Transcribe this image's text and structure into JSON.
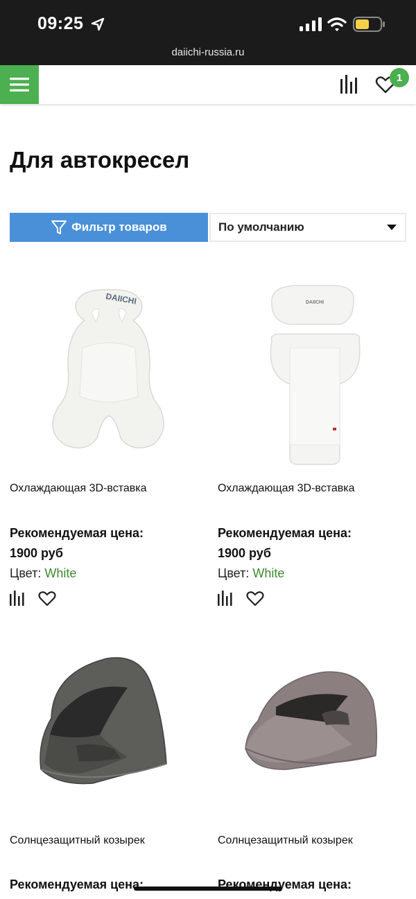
{
  "status_bar": {
    "time": "09:25",
    "url": "daiichi-russia.ru",
    "icons": [
      "location-arrow-icon",
      "signal-icon",
      "wifi-icon",
      "battery-icon"
    ]
  },
  "header": {
    "menu_icon": "hamburger-icon",
    "compare_icon": "compare-icon",
    "favorites_icon": "heart-icon",
    "favorites_count": "1",
    "accent_color": "#4caf50"
  },
  "page": {
    "title": "Для автокресел"
  },
  "filter": {
    "filter_label": "Фильтр товаров",
    "filter_icon": "funnel-icon",
    "filter_color": "#4a90d9",
    "sort_selected": "По умолчанию",
    "sort_icon": "caret-down-icon"
  },
  "products": [
    {
      "name": "Охлаждающая 3D-вставка",
      "price_label": "Рекомендуемая цена:",
      "price": "1900 руб",
      "color_label": "Цвет:",
      "color_value": "White",
      "image_text": "DAIICHI"
    },
    {
      "name": "Охлаждающая 3D-вставка",
      "price_label": "Рекомендуемая цена:",
      "price": "1900 руб",
      "color_label": "Цвет:",
      "color_value": "White",
      "image_text": "DAIICHI"
    },
    {
      "name": "Солнцезащитный козырек",
      "price_label": "Рекомендуемая цена:"
    },
    {
      "name": "Солнцезащитный козырек",
      "price_label": "Рекомендуемая цена:"
    }
  ]
}
